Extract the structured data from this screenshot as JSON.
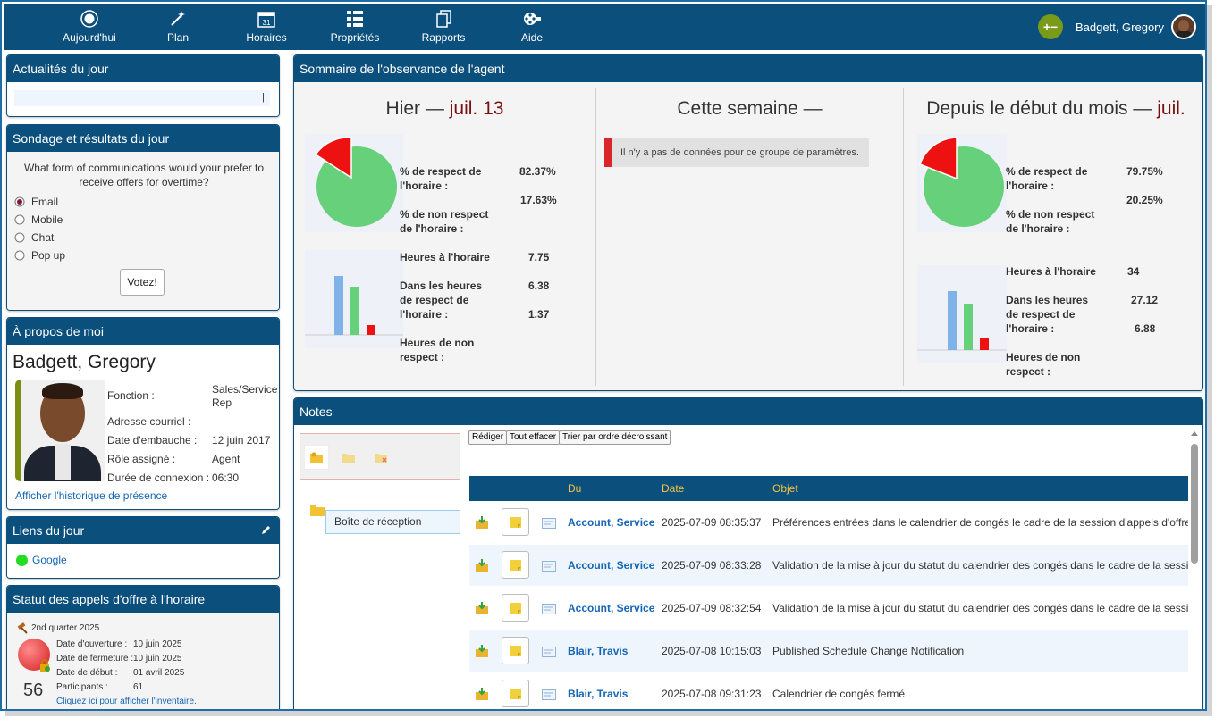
{
  "nav": {
    "items": [
      {
        "label": "Aujourd'hui",
        "icon": "sun-icon"
      },
      {
        "label": "Plan",
        "icon": "wand-icon"
      },
      {
        "label": "Horaires",
        "icon": "calendar-icon"
      },
      {
        "label": "Propriétés",
        "icon": "list-icon"
      },
      {
        "label": "Rapports",
        "icon": "reports-icon"
      },
      {
        "label": "Aide",
        "icon": "film-icon"
      }
    ],
    "calendar_day": "31",
    "user_name": "Badgett, Gregory",
    "plus_minus": "+−"
  },
  "news": {
    "title": "Actualités du jour",
    "ticker": "|"
  },
  "poll": {
    "title": "Sondage et résultats du jour",
    "question": "What form of communications would your prefer to receive offers for overtime?",
    "options": [
      "Email",
      "Mobile",
      "Chat",
      "Pop up"
    ],
    "selected": "Email",
    "vote_label": "Votez!"
  },
  "about": {
    "title": "À propos de moi",
    "name": "Badgett, Gregory",
    "fields": [
      {
        "label": "Fonction :",
        "value": "Sales/Service Rep"
      },
      {
        "label": "Adresse courriel :",
        "value": ""
      },
      {
        "label": "Date d'embauche :",
        "value": "12 juin 2017"
      },
      {
        "label": "Rôle assigné :",
        "value": "Agent"
      },
      {
        "label": "Durée de connexion :",
        "value": "06:30"
      }
    ],
    "history_link": "Afficher l'historique de présence"
  },
  "links": {
    "title": "Liens du jour",
    "items": [
      {
        "label": "Google",
        "color": "#22dd22"
      }
    ]
  },
  "offers": {
    "title": "Statut des appels d'offre à l'horaire",
    "quarter": "2nd quarter 2025",
    "count": "56",
    "fields": [
      {
        "label": "Date d'ouverture :",
        "value": "10 juin 2025"
      },
      {
        "label": "Date de fermeture :",
        "value": "10 juin 2025"
      },
      {
        "label": "Date de début :",
        "value": "01 avril 2025"
      },
      {
        "label": "Participants :",
        "value": "61"
      }
    ],
    "inventory_link": "Cliquez ici pour afficher l'inventaire."
  },
  "summary": {
    "title": "Sommaire de l'observance de l'agent",
    "yesterday": {
      "heading": "Hier — ",
      "date": "juil. 13",
      "respect_label": "% de respect de l'horaire :",
      "respect_value": "82.37%",
      "nonrespect_label": "% de non respect de l'horaire :",
      "nonrespect_value": "17.63%",
      "hours_label": "Heures à l'horaire",
      "hours_value": "7.75",
      "in_label": "Dans les heures de respect de l'horaire :",
      "in_value": "6.38",
      "out_label": "Heures de non respect :",
      "out_value": "1.37"
    },
    "week": {
      "heading": "Cette semaine —",
      "empty_message": "Il n'y a pas de données pour ce groupe de paramètres."
    },
    "month": {
      "heading": "Depuis le début du mois — ",
      "date": "juil.",
      "respect_label": "% de respect de l'horaire :",
      "respect_value": "79.75%",
      "nonrespect_label": "% de non respect de l'horaire :",
      "nonrespect_value": "20.25%",
      "hours_label": "Heures à l'horaire",
      "hours_value": "34",
      "in_label": "Dans les heures de respect de l'horaire :",
      "in_value": "27.12",
      "out_label": "Heures de non respect :",
      "out_value": "6.88"
    },
    "colors": {
      "respect": "#66d17a",
      "nonrespect": "#ee1111",
      "scheduled": "#7fb3e8"
    }
  },
  "notes": {
    "title": "Notes",
    "inbox_label": "Boîte de réception",
    "buttons": [
      "Rédiger",
      "Tout effacer",
      "Trier par ordre décroissant"
    ],
    "columns": [
      "Du",
      "Date",
      "Objet"
    ],
    "rows": [
      {
        "from": "Account, Service",
        "date": "2025-07-09 08:35:37",
        "subject": "Préférences entrées dans le calendrier de congés le cadre de la session d'appels d'offre"
      },
      {
        "from": "Account, Service",
        "date": "2025-07-09 08:33:28",
        "subject": "Validation de la mise à jour du statut du calendrier des congés dans le cadre de la session d'appels d'offre"
      },
      {
        "from": "Account, Service",
        "date": "2025-07-09 08:32:54",
        "subject": "Validation de la mise à jour du statut du calendrier des congés dans le cadre de la session d'appels d'offre"
      },
      {
        "from": "Blair, Travis",
        "date": "2025-07-08 10:15:03",
        "subject": "Published Schedule Change Notification"
      },
      {
        "from": "Blair, Travis",
        "date": "2025-07-08 09:31:23",
        "subject": "Calendrier de congés fermé"
      }
    ]
  }
}
